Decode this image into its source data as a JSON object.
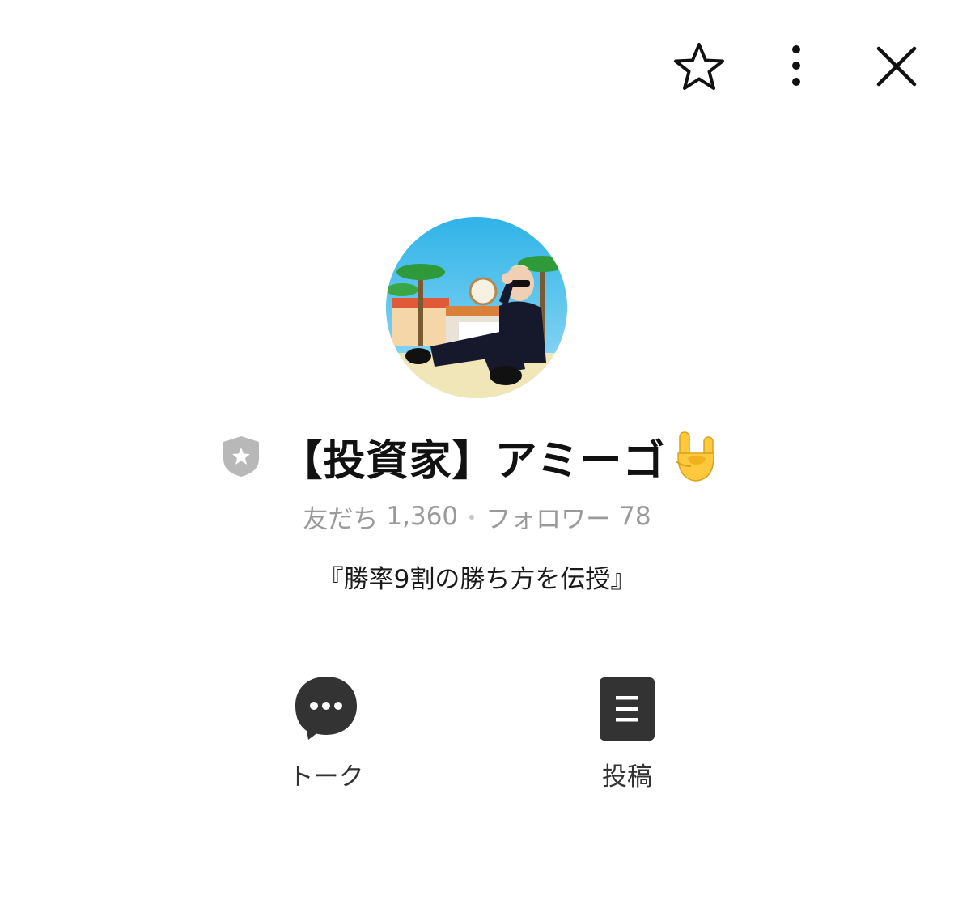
{
  "header": {
    "favorite_icon": "star-outline-icon",
    "more_icon": "vertical-dots-icon",
    "close_icon": "close-x-icon"
  },
  "profile": {
    "badge_icon": "gray-shield-star-icon",
    "name": "【投資家】アミーゴ",
    "name_emoji": "🤘",
    "friends_label": "友だち",
    "friends_count": "1,360",
    "followers_label": "フォロワー",
    "followers_count": "78",
    "status_message": "『勝率9割の勝ち方を伝授』"
  },
  "actions": [
    {
      "label": "トーク",
      "icon": "chat-bubble-icon"
    },
    {
      "label": "投稿",
      "icon": "post-document-icon"
    }
  ],
  "colors": {
    "icon_dark": "#333333",
    "muted_text": "#9a9a9a",
    "badge_gray": "#b8b8b8"
  }
}
